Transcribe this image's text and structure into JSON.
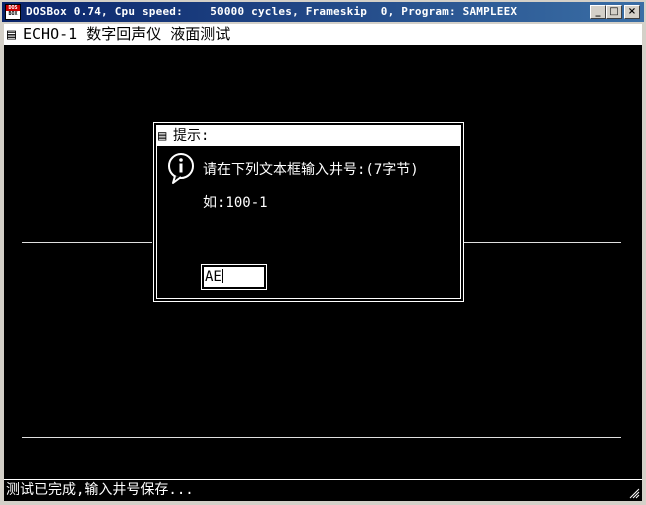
{
  "window": {
    "icon_label_top": "DOS",
    "icon_label_bottom": "BOX",
    "title": "DOSBox 0.74, Cpu speed:    50000 cycles, Frameskip  0, Program: SAMPLEEX",
    "minimize_glyph": "_",
    "maximize_glyph": "□",
    "close_glyph": "×"
  },
  "app": {
    "header_glyph": "▤",
    "header_title": "ECHO-1 数字回声仪 液面测试"
  },
  "dialog": {
    "title_glyph": "▤",
    "title": "提示:",
    "message": "请在下列文本框输入井号:(7字节)",
    "example": "如:100-1",
    "input_value": "AE",
    "info_icon": "info-icon"
  },
  "status": {
    "text": "测试已完成,输入井号保存..."
  },
  "colors": {
    "titlebar_start": "#0a246a",
    "titlebar_end": "#3a6ea5",
    "screen_bg": "#000000",
    "text": "#ffffff"
  }
}
